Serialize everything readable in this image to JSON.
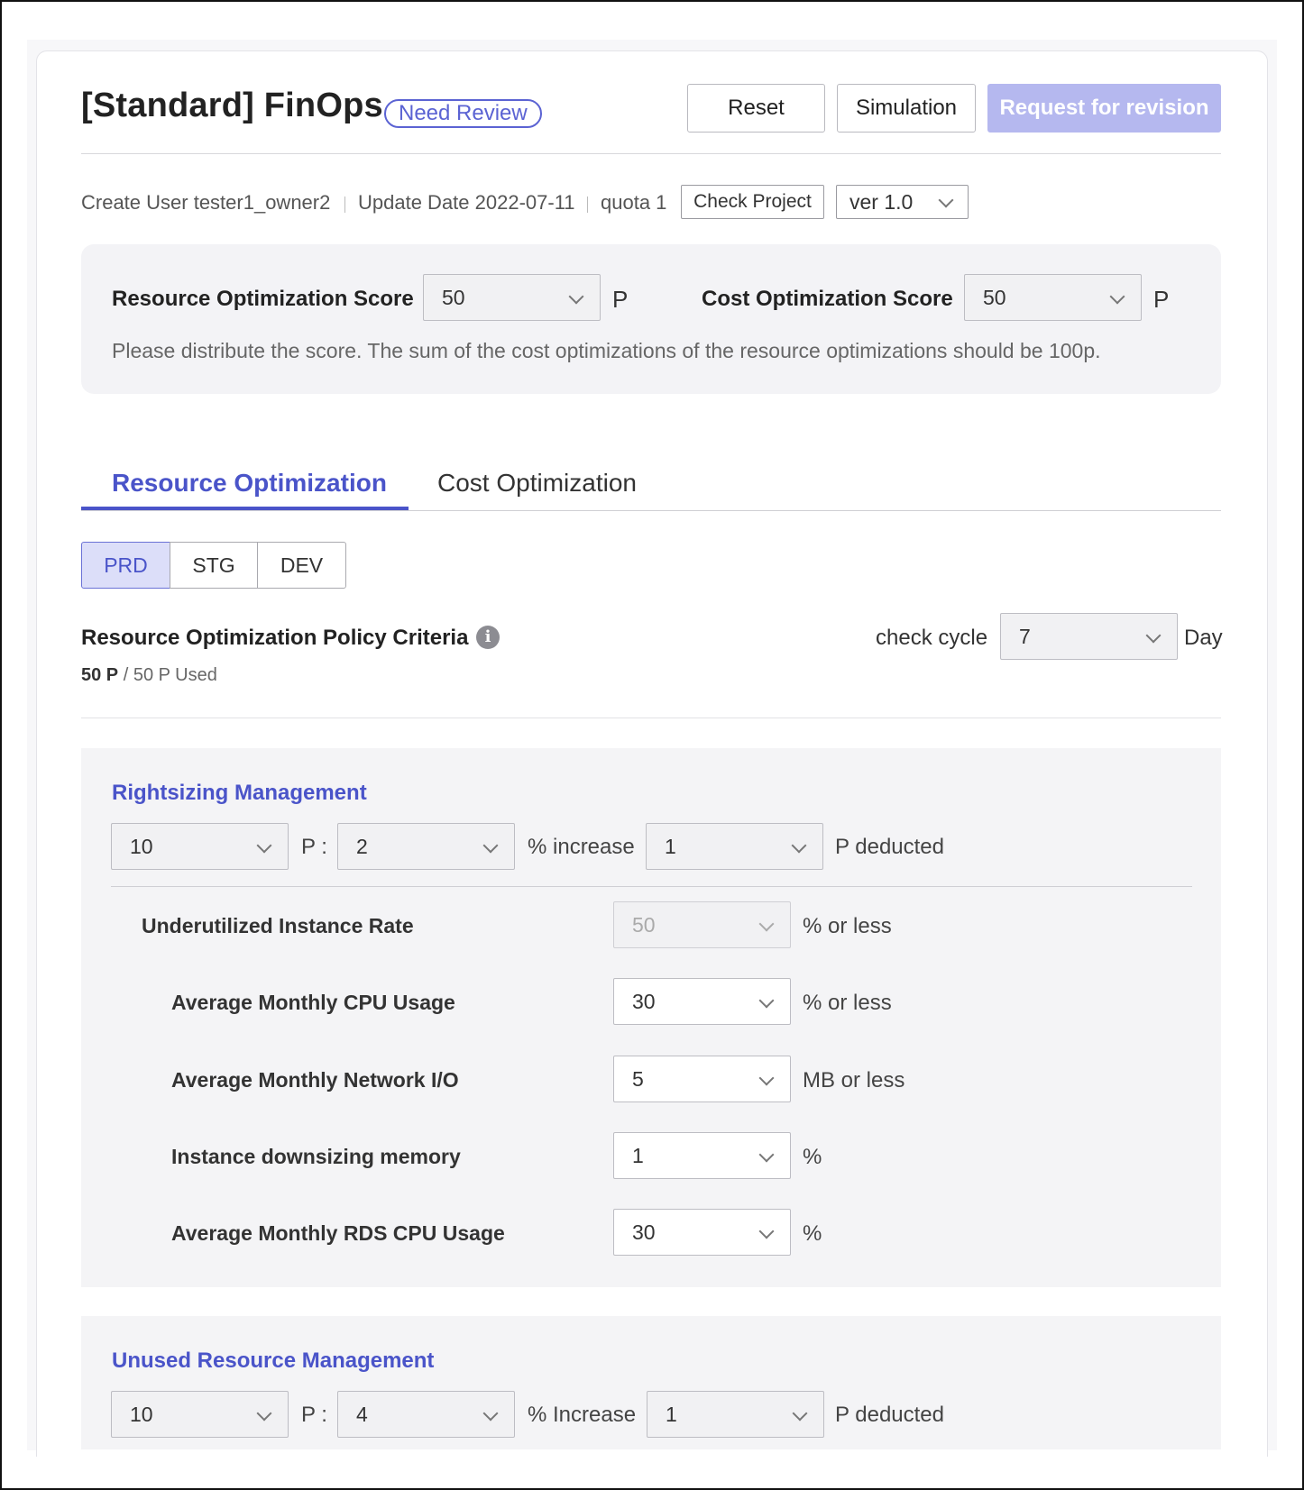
{
  "header": {
    "title": "[Standard] FinOps",
    "badge": "Need Review",
    "reset_label": "Reset",
    "simulation_label": "Simulation",
    "request_label": "Request for revision"
  },
  "meta": {
    "create_user": "Create User tester1_owner2",
    "update_date": "Update Date 2022-07-11",
    "quota": "quota 1",
    "check_project_label": "Check Project",
    "version": "ver 1.0"
  },
  "scores": {
    "resource_label": "Resource Optimization Score",
    "resource_value": "50",
    "resource_unit": "P",
    "cost_label": "Cost Optimization Score",
    "cost_value": "50",
    "cost_unit": "P",
    "hint": "Please distribute the score. The sum of the cost optimizations of the resource optimizations should be 100p."
  },
  "tabs": [
    {
      "label": "Resource Optimization",
      "active": true
    },
    {
      "label": "Cost Optimization",
      "active": false
    }
  ],
  "env_tabs": [
    {
      "label": "PRD",
      "active": true
    },
    {
      "label": "STG",
      "active": false
    },
    {
      "label": "DEV",
      "active": false
    }
  ],
  "policy": {
    "title": "Resource Optimization Policy Criteria",
    "used_bold": "50 P",
    "used_rest": "/ 50 P Used",
    "check_cycle_label": "check cycle",
    "check_cycle_value": "7",
    "check_cycle_unit": "Day"
  },
  "rightsizing": {
    "title": "Rightsizing Management",
    "points": "10",
    "points_sep": "P :",
    "increase": "2",
    "increase_label": "% increase",
    "deducted": "1",
    "deducted_label": "P deducted",
    "rows": [
      {
        "label": "Underutilized Instance Rate",
        "value": "50",
        "unit": "% or less",
        "disabled": true
      },
      {
        "label": "Average Monthly CPU Usage",
        "value": "30",
        "unit": "% or less",
        "disabled": false
      },
      {
        "label": "Average Monthly Network I/O",
        "value": "5",
        "unit": "MB or less",
        "disabled": false
      },
      {
        "label": "Instance downsizing memory",
        "value": "1",
        "unit": "%",
        "disabled": false
      },
      {
        "label": "Average Monthly RDS CPU Usage",
        "value": "30",
        "unit": "%",
        "disabled": false
      }
    ]
  },
  "unused": {
    "title": "Unused Resource Management",
    "points": "10",
    "points_sep": "P :",
    "increase": "4",
    "increase_label": "% Increase",
    "deducted": "1",
    "deducted_label": "P deducted"
  },
  "colors": {
    "accent": "#4a54c9",
    "primary_button_disabled": "#b5b8ef",
    "panel_bg": "#f4f4f6"
  }
}
